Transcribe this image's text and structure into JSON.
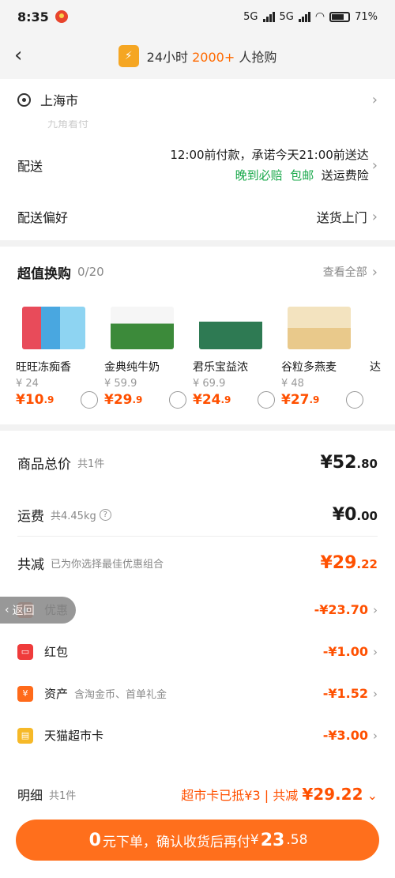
{
  "status": {
    "time": "8:35",
    "net1": "5G",
    "net2": "5G",
    "battery": "71"
  },
  "header": {
    "prefix": "24小时",
    "count": "2000+",
    "suffix": "人抢购"
  },
  "address": {
    "city": "上海市",
    "hidden_text": "九角着付"
  },
  "delivery": {
    "label": "配送",
    "line1": "12:00前付款，承诺今天21:00前送达",
    "tags": [
      "晚到必赔",
      "包邮"
    ],
    "insurance": "送运费险"
  },
  "preference": {
    "label": "配送偏好",
    "value": "送货上门"
  },
  "swap": {
    "title": "超值换购",
    "count": "0/20",
    "view_all": "查看全部",
    "products": [
      {
        "name": "旺旺冻痴香",
        "old": "¥ 24",
        "new_int": "¥10",
        "new_dec": ".9",
        "color": "#e84b5a"
      },
      {
        "name": "金典纯牛奶",
        "old": "¥ 59.9",
        "new_int": "¥29",
        "new_dec": ".9",
        "color": "#3c8a3a"
      },
      {
        "name": "君乐宝益浓",
        "old": "¥ 69.9",
        "new_int": "¥24",
        "new_dec": ".9",
        "color": "#2e7a53"
      },
      {
        "name": "谷粒多燕麦",
        "old": "¥ 48",
        "new_int": "¥27",
        "new_dec": ".9",
        "color": "#e9c98b"
      }
    ],
    "partial_name": "达"
  },
  "prices": {
    "goods_label": "商品总价",
    "goods_sub": "共1件",
    "goods_amt": "¥52",
    "goods_dec": ".80",
    "ship_label": "运费",
    "ship_sub": "共4.45kg",
    "ship_amt": "¥0",
    "ship_dec": ".00",
    "reduce_label": "共减",
    "reduce_sub": "已为你选择最佳优惠组合",
    "reduce_amt": "¥29",
    "reduce_dec": ".22",
    "details": [
      {
        "label": "优惠",
        "amount": "-¥23.70",
        "sub": ""
      },
      {
        "label": "红包",
        "amount": "-¥1.00",
        "sub": ""
      },
      {
        "label": "资产",
        "amount": "-¥1.52",
        "sub": "含淘金币、首单礼金"
      },
      {
        "label": "天猫超市卡",
        "amount": "-¥3.00",
        "sub": ""
      }
    ]
  },
  "return_button": "返回",
  "footer": {
    "label": "明细",
    "sub": "共1件",
    "card_deduct": "超市卡已抵¥3",
    "reduce_label": "共减",
    "reduce_amount": "¥29.22",
    "cta_zero": "0",
    "cta_text": "元下单，确认收货后再付",
    "cta_cur": "¥",
    "cta_int": "23",
    "cta_dec": ".58"
  },
  "colors": {
    "accent": "#ff5000",
    "button": "#ff6f1c",
    "green": "#18a84a"
  }
}
